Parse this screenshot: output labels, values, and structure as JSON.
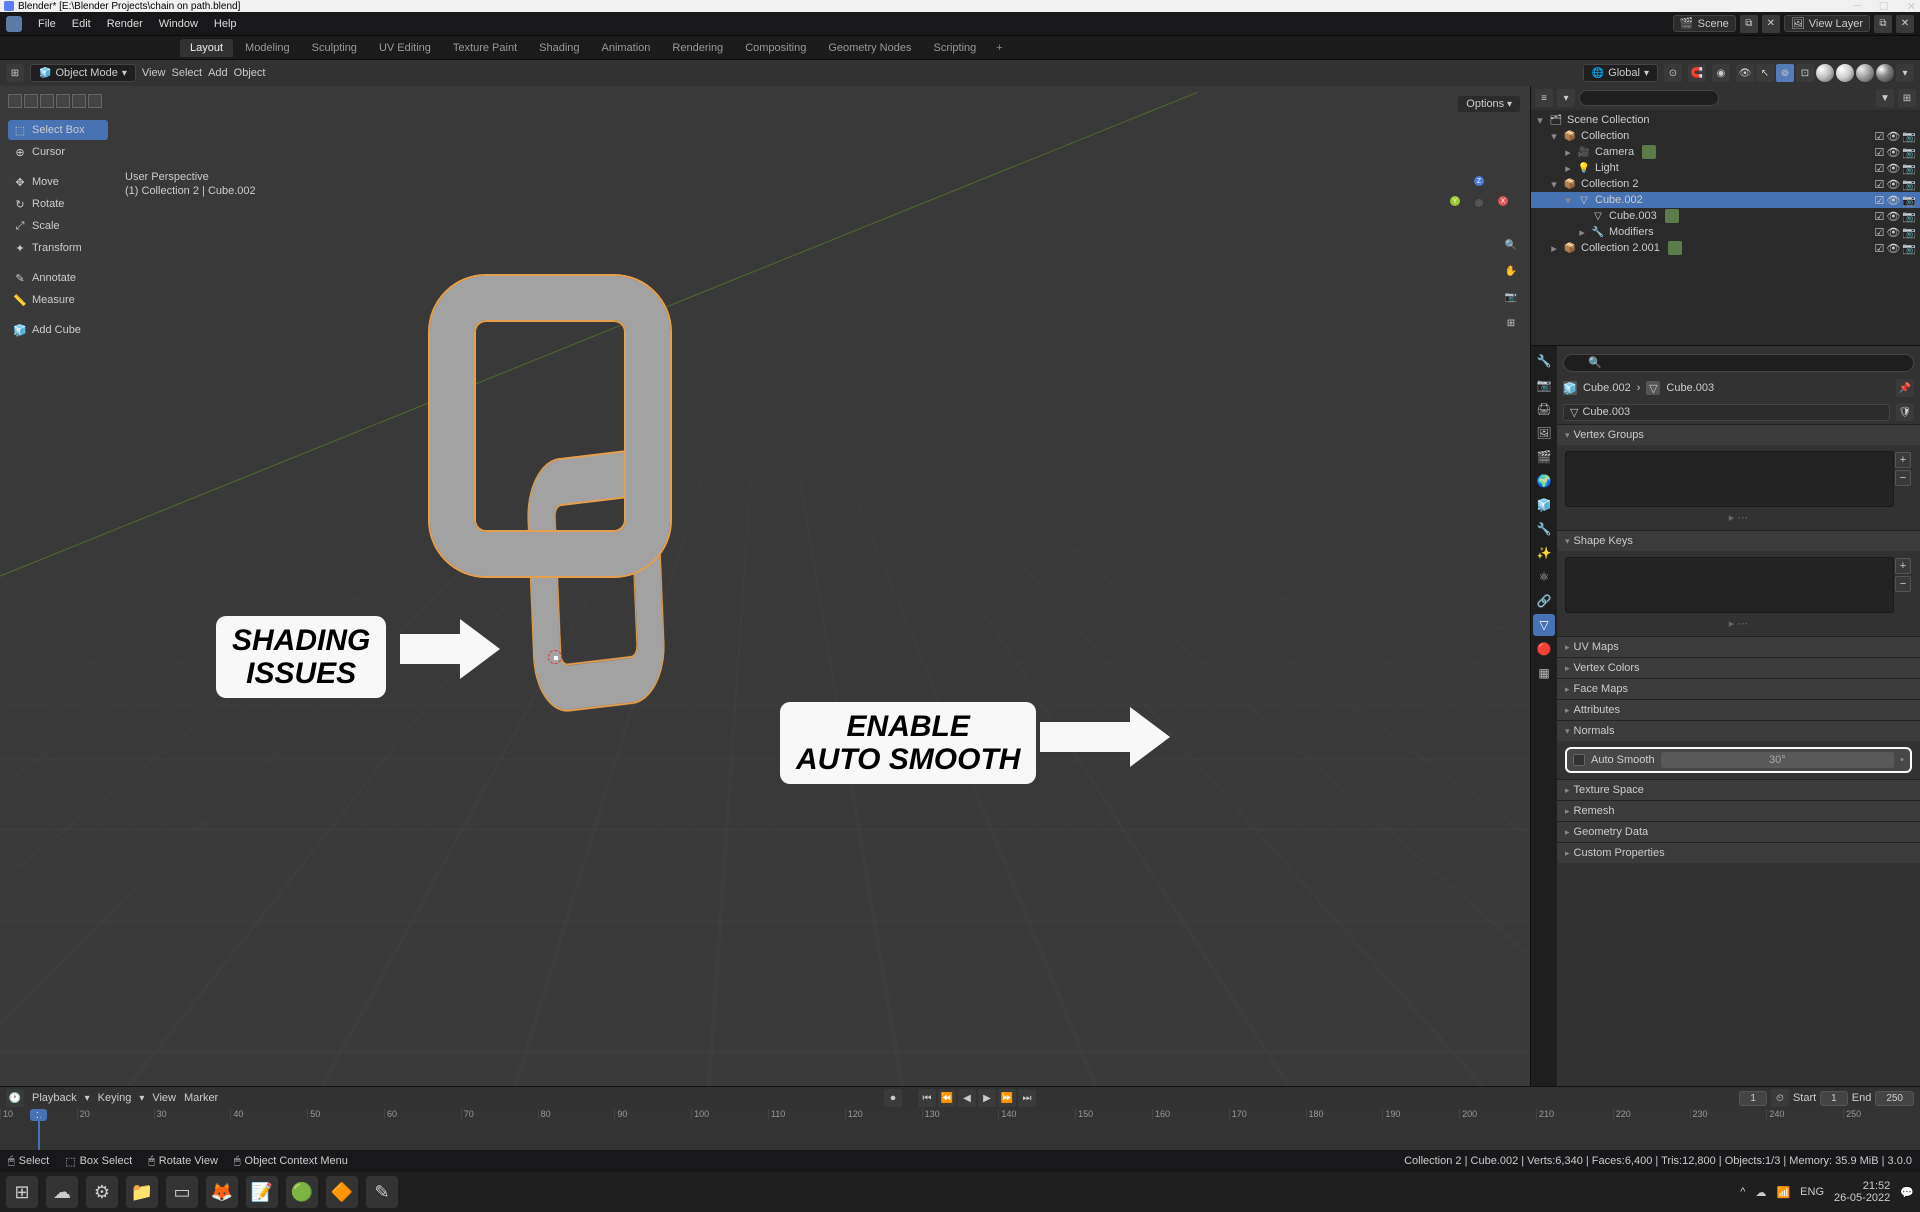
{
  "titlebar": {
    "text": "Blender* [E:\\Blender Projects\\chain on path.blend]"
  },
  "menubar": {
    "items": [
      "File",
      "Edit",
      "Render",
      "Window",
      "Help"
    ]
  },
  "workspaces": [
    "Layout",
    "Modeling",
    "Sculpting",
    "UV Editing",
    "Texture Paint",
    "Shading",
    "Animation",
    "Rendering",
    "Compositing",
    "Geometry Nodes",
    "Scripting"
  ],
  "hdr": {
    "mode": "Object Mode",
    "menus": [
      "View",
      "Select",
      "Add",
      "Object"
    ],
    "orientation": "Global",
    "options": "Options"
  },
  "hdr_right": {
    "scene": "Scene",
    "viewlayer": "View Layer"
  },
  "tools": [
    "Select Box",
    "Cursor",
    "Move",
    "Rotate",
    "Scale",
    "Transform",
    "Annotate",
    "Measure",
    "Add Cube"
  ],
  "vp_overlay": {
    "line1": "User Perspective",
    "line2": "(1) Collection 2 | Cube.002"
  },
  "callouts": {
    "shading": "SHADING\nISSUES",
    "enable": "ENABLE\nAUTO SMOOTH"
  },
  "outliner": {
    "root": "Scene Collection",
    "rows": [
      {
        "indent": 1,
        "name": "Collection",
        "icon": "📦",
        "tw": "▾"
      },
      {
        "indent": 2,
        "name": "Camera",
        "icon": "🎥",
        "tw": "▸",
        "badge": true
      },
      {
        "indent": 2,
        "name": "Light",
        "icon": "💡",
        "tw": "▸"
      },
      {
        "indent": 1,
        "name": "Collection 2",
        "icon": "📦",
        "tw": "▾"
      },
      {
        "indent": 2,
        "name": "Cube.002",
        "icon": "▽",
        "tw": "▾",
        "sel": true
      },
      {
        "indent": 3,
        "name": "Cube.003",
        "icon": "▽",
        "tw": "",
        "badge": true
      },
      {
        "indent": 3,
        "name": "Modifiers",
        "icon": "🔧",
        "tw": "▸"
      },
      {
        "indent": 1,
        "name": "Collection 2.001",
        "icon": "📦",
        "tw": "▸",
        "badge": true
      }
    ]
  },
  "properties": {
    "breadcrumb": {
      "a": "Cube.002",
      "b": "Cube.003"
    },
    "datablock": "Cube.003",
    "panels": [
      "Vertex Groups",
      "Shape Keys",
      "UV Maps",
      "Vertex Colors",
      "Face Maps",
      "Attributes",
      "Normals",
      "Texture Space",
      "Remesh",
      "Geometry Data",
      "Custom Properties"
    ],
    "autosmooth": {
      "label": "Auto Smooth",
      "angle": "30°"
    }
  },
  "timeline": {
    "menus": [
      "Playback",
      "Keying",
      "View",
      "Marker"
    ],
    "current": "1",
    "start_lbl": "Start",
    "start": "1",
    "end_lbl": "End",
    "end": "250",
    "ticks": [
      "10",
      "20",
      "30",
      "40",
      "50",
      "60",
      "70",
      "80",
      "90",
      "100",
      "110",
      "120",
      "130",
      "140",
      "150",
      "160",
      "170",
      "180",
      "190",
      "200",
      "210",
      "220",
      "230",
      "240",
      "250"
    ]
  },
  "status": {
    "left": [
      {
        "icon": "🖱",
        "text": "Select"
      },
      {
        "icon": "⬚",
        "text": "Box Select"
      },
      {
        "icon": "↻",
        "text": "Rotate View"
      },
      {
        "icon": "☰",
        "text": "Object Context Menu"
      }
    ],
    "right": "Collection 2 | Cube.002 | Verts:6,340 | Faces:6,400 | Tris:12,800 | Objects:1/3 | Memory: 35.9 MiB | 3.0.0"
  },
  "systray": {
    "lang": "ENG",
    "time": "21:52",
    "date": "26-05-2022"
  }
}
